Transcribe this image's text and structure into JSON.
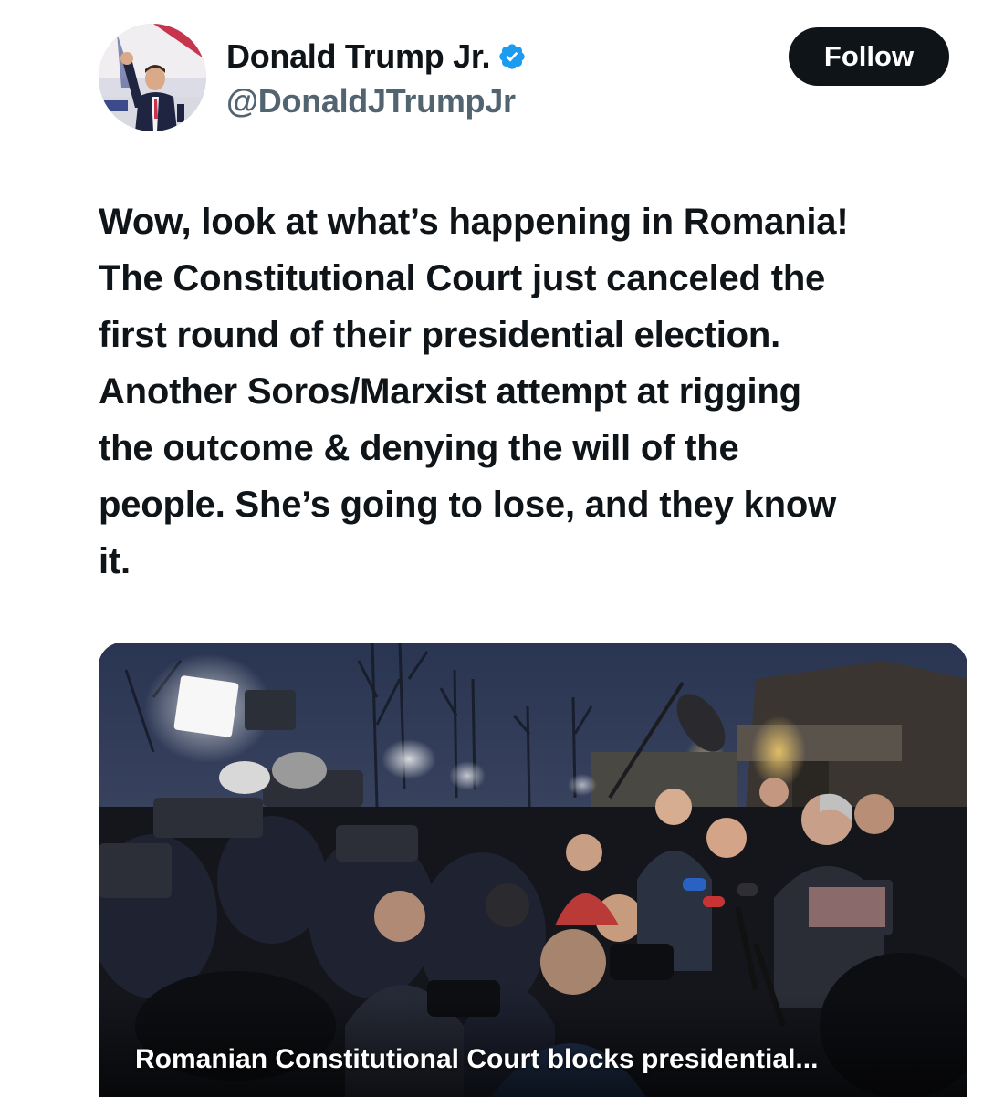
{
  "author": {
    "display_name": "Donald Trump Jr.",
    "handle": "@DonaldJTrumpJr",
    "verified": true,
    "verified_color": "#1d9bf0"
  },
  "actions": {
    "follow_label": "Follow"
  },
  "tweet": {
    "text": "Wow, look at what’s happening in Romania!\nThe Constitutional Court just canceled the\nfirst round of their presidential election.\nAnother Soros/Marxist attempt at rigging\nthe outcome & denying the will of the\npeople. She’s going to lose, and they know\nit."
  },
  "link_card": {
    "caption": "Romanian Constitutional Court blocks presidential..."
  },
  "icons": {
    "verified": "verified-badge-icon"
  },
  "colors": {
    "text_primary": "#0f1419",
    "text_secondary": "#536471",
    "follow_bg": "#0f1419",
    "follow_text": "#ffffff"
  }
}
